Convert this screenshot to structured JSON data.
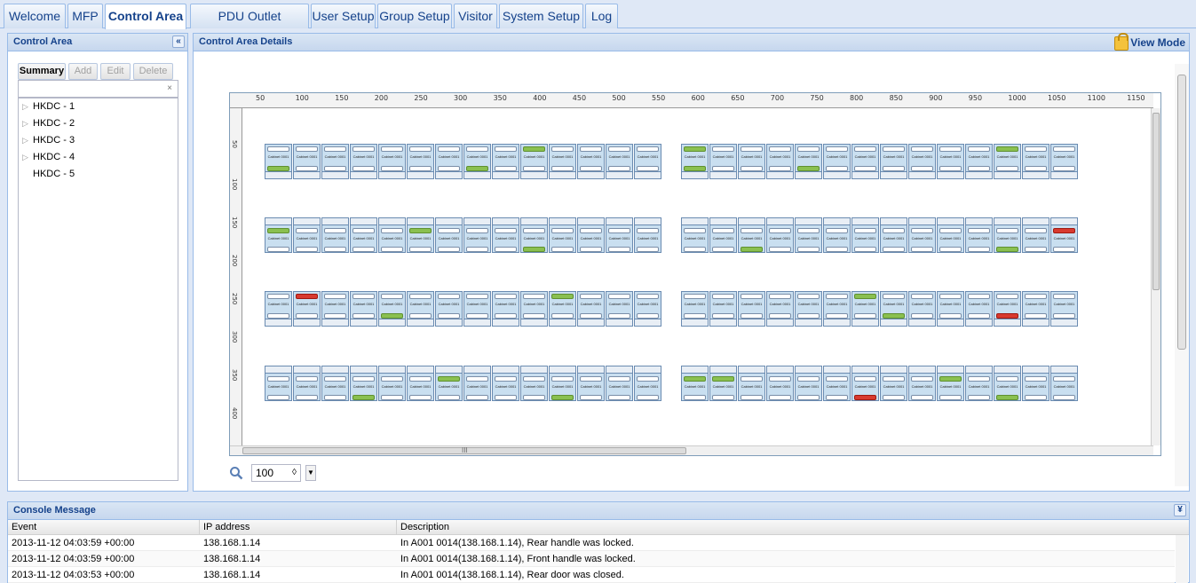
{
  "tabs": [
    {
      "label": "Welcome",
      "active": false
    },
    {
      "label": "MFP",
      "active": false
    },
    {
      "label": "Control Area",
      "active": true
    },
    {
      "label": "PDU Outlet Grouping",
      "active": false
    },
    {
      "label": "User Setup",
      "active": false
    },
    {
      "label": "Group Setup",
      "active": false
    },
    {
      "label": "Visitor",
      "active": false
    },
    {
      "label": "System Setup",
      "active": false
    },
    {
      "label": "Log",
      "active": false
    }
  ],
  "control_area": {
    "title": "Control Area",
    "collapse_glyph": "«",
    "buttons": {
      "summary": "Summary",
      "add": "Add",
      "edit": "Edit",
      "delete": "Delete"
    },
    "search_value": "",
    "clear_glyph": "×",
    "tree": [
      {
        "label": "HKDC - 1",
        "expandable": true
      },
      {
        "label": "HKDC - 2",
        "expandable": true
      },
      {
        "label": "HKDC - 3",
        "expandable": true
      },
      {
        "label": "HKDC - 4",
        "expandable": true
      },
      {
        "label": "HKDC - 5",
        "expandable": false
      }
    ]
  },
  "details": {
    "title": "Control Area Details",
    "view_mode_label": "View Mode",
    "lock_icon": "lock-icon",
    "h_ticks": [
      "50",
      "100",
      "150",
      "200",
      "250",
      "300",
      "350",
      "400",
      "450",
      "500",
      "550",
      "600",
      "650",
      "700",
      "750",
      "800",
      "850",
      "900",
      "950",
      "1000",
      "1050",
      "1100",
      "1150"
    ],
    "v_ticks": [
      "50",
      "100",
      "150",
      "200",
      "250",
      "300",
      "350",
      "400",
      "450"
    ],
    "zoom_value": "100",
    "zoom_spinner_glyph": "◊",
    "scroll_glyph": "III",
    "rack_label": "Cabinet 0001"
  },
  "rack_rows": [
    {
      "outlets": "bottom",
      "groups": [
        {
          "top": [
            "",
            "",
            "",
            "",
            "",
            "",
            "",
            "",
            "",
            "green",
            "",
            "",
            "",
            ""
          ],
          "bot": [
            "green",
            "",
            "",
            "",
            "",
            "",
            "",
            "green",
            "",
            "",
            "",
            "",
            "",
            ""
          ]
        },
        {
          "top": [
            "green",
            "",
            "",
            "",
            "",
            "",
            "",
            "",
            "",
            "",
            "",
            "green",
            "",
            ""
          ],
          "bot": [
            "green",
            "",
            "",
            "",
            "green",
            "",
            "",
            "",
            "",
            "",
            "",
            "",
            "",
            ""
          ]
        }
      ]
    },
    {
      "outlets": "top",
      "groups": [
        {
          "top": [
            "green",
            "",
            "",
            "",
            "",
            "green",
            "",
            "",
            "",
            "",
            "",
            "",
            "",
            ""
          ],
          "bot": [
            "",
            "",
            "",
            "",
            "",
            "",
            "",
            "",
            "",
            "green",
            "",
            "",
            "",
            ""
          ]
        },
        {
          "top": [
            "",
            "",
            "",
            "",
            "",
            "",
            "",
            "",
            "",
            "",
            "",
            "",
            "",
            "red"
          ],
          "bot": [
            "",
            "",
            "green",
            "",
            "",
            "",
            "",
            "",
            "",
            "",
            "",
            "green",
            "",
            ""
          ]
        }
      ]
    },
    {
      "outlets": "bottom",
      "groups": [
        {
          "top": [
            "",
            "red",
            "",
            "",
            "",
            "",
            "",
            "",
            "",
            "",
            "green",
            "",
            "",
            ""
          ],
          "bot": [
            "",
            "",
            "",
            "",
            "green",
            "",
            "",
            "",
            "",
            "",
            "",
            "",
            "",
            ""
          ]
        },
        {
          "top": [
            "",
            "",
            "",
            "",
            "",
            "",
            "green",
            "",
            "",
            "",
            "",
            "",
            "",
            ""
          ],
          "bot": [
            "",
            "",
            "",
            "",
            "",
            "",
            "",
            "green",
            "",
            "",
            "",
            "red",
            "",
            ""
          ]
        }
      ]
    },
    {
      "outlets": "top",
      "groups": [
        {
          "top": [
            "",
            "",
            "",
            "",
            "",
            "",
            "green",
            "",
            "",
            "",
            "",
            "",
            "",
            ""
          ],
          "bot": [
            "",
            "",
            "",
            "green",
            "",
            "",
            "",
            "",
            "",
            "",
            "green",
            "",
            "",
            ""
          ]
        },
        {
          "top": [
            "green",
            "green",
            "",
            "",
            "",
            "",
            "",
            "",
            "",
            "green",
            "",
            "",
            "",
            ""
          ],
          "bot": [
            "",
            "",
            "",
            "",
            "",
            "",
            "red",
            "",
            "",
            "",
            "",
            "green",
            "",
            ""
          ]
        }
      ]
    }
  ],
  "console": {
    "title": "Console Message",
    "expand_glyph": "¥",
    "columns": [
      "Event",
      "IP address",
      "Description"
    ],
    "rows": [
      {
        "event": "2013-11-12 04:03:59 +00:00",
        "ip": "138.168.1.14",
        "description": "In A001 0014(138.168.1.14), Rear handle was locked."
      },
      {
        "event": "2013-11-12 04:03:59 +00:00",
        "ip": "138.168.1.14",
        "description": "In A001 0014(138.168.1.14), Front handle was locked."
      },
      {
        "event": "2013-11-12 04:03:53 +00:00",
        "ip": "138.168.1.14",
        "description": "In A001 0014(138.168.1.14), Rear door was closed."
      }
    ]
  },
  "colors": {
    "accent": "#15428b",
    "border": "#99bbe8",
    "ok": "#8ac050",
    "alarm": "#d83a2f",
    "rack_fill": "#c9dff0"
  }
}
